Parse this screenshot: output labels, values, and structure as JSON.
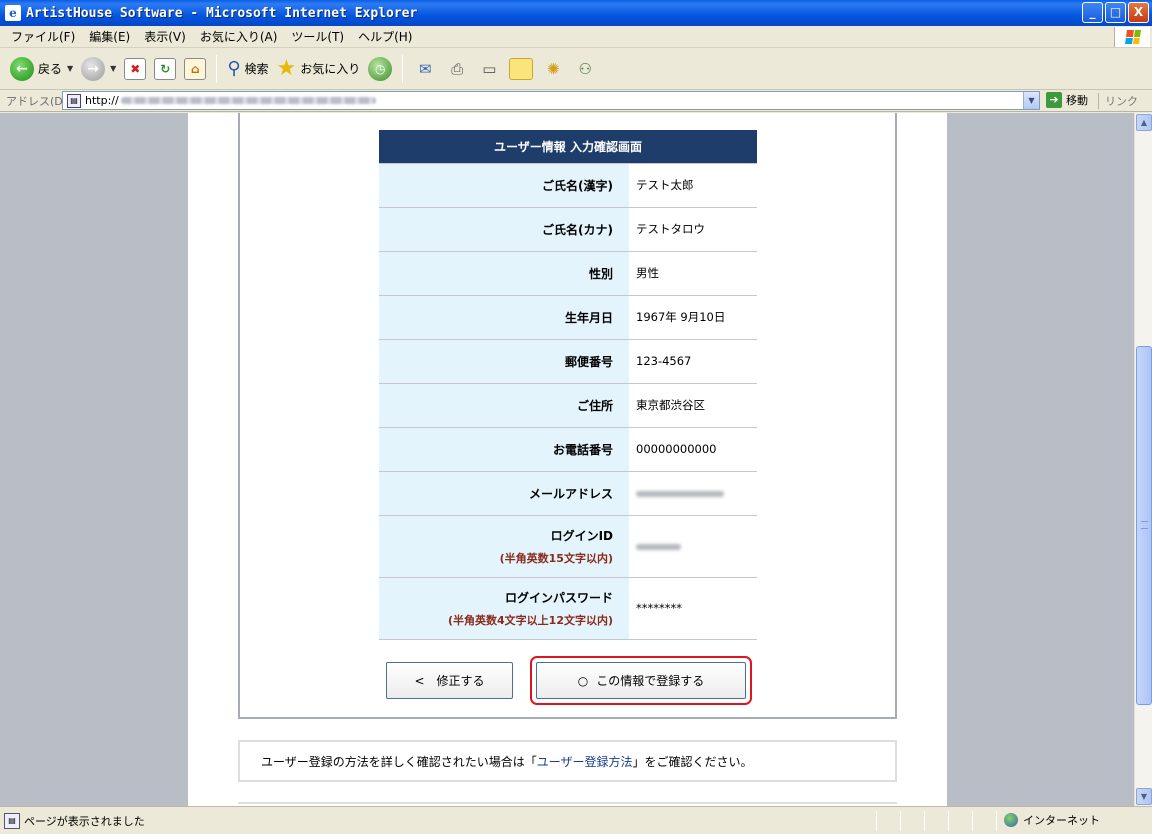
{
  "window": {
    "title": "ArtistHouse Software - Microsoft Internet Explorer",
    "buttons": {
      "minimize": "_",
      "maximize": "□",
      "close": "X"
    }
  },
  "menu": {
    "items": [
      "ファイル(F)",
      "編集(E)",
      "表示(V)",
      "お気に入り(A)",
      "ツール(T)",
      "ヘルプ(H)"
    ]
  },
  "toolbar": {
    "back_label": "戻る",
    "search_label": "検索",
    "favorites_label": "お気に入り"
  },
  "address": {
    "label": "アドレス(D)",
    "url_prefix": "http://",
    "go_label": "移動",
    "links_label": "リンク"
  },
  "form": {
    "header": "ユーザー情報 入力確認画面",
    "rows": [
      {
        "label": "ご氏名(漢字)",
        "value": "テスト太郎"
      },
      {
        "label": "ご氏名(カナ)",
        "value": "テストタロウ"
      },
      {
        "label": "性別",
        "value": "男性"
      },
      {
        "label": "生年月日",
        "value": "1967年 9月10日"
      },
      {
        "label": "郵便番号",
        "value": "123-4567"
      },
      {
        "label": "ご住所",
        "value": "東京都渋谷区"
      },
      {
        "label": "お電話番号",
        "value": "00000000000"
      },
      {
        "label": "メールアドレス",
        "value": ""
      },
      {
        "label": "ログインID",
        "note": "(半角英数15文字以内)",
        "value": ""
      },
      {
        "label": "ログインパスワード",
        "note": "(半角英数4文字以上12文字以内)",
        "value": "********"
      }
    ],
    "back_button": "<　修正する",
    "submit_mark": "○",
    "submit_button": "この情報で登録する"
  },
  "info": {
    "prefix": "ユーザー登録の方法を詳しく確認されたい場合は「",
    "link": "ユーザー登録方法",
    "suffix": "」をご確認ください。"
  },
  "status": {
    "text": "ページが表示されました",
    "zone": "インターネット"
  },
  "colors": {
    "header_bg": "#1f3d6b",
    "label_bg": "#e3f4fc",
    "note_color": "#8a2a1a",
    "highlight": "#e0141e"
  }
}
